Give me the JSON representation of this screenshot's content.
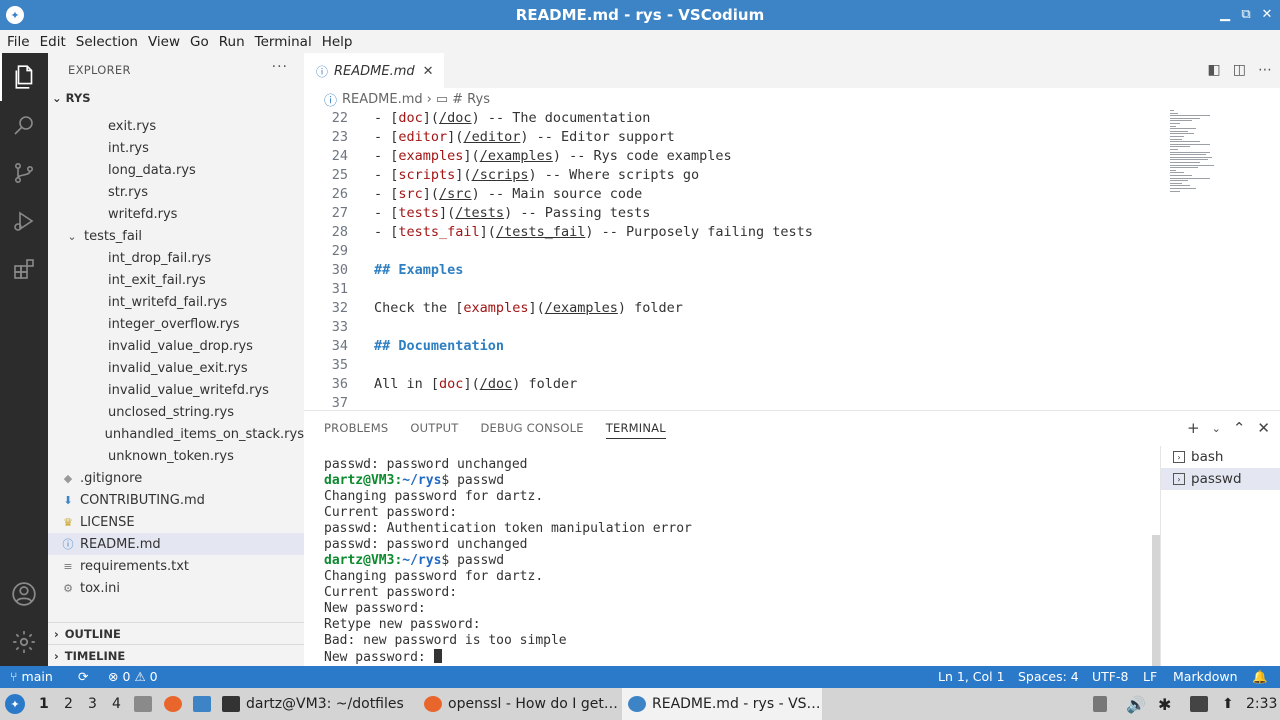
{
  "window": {
    "title": "README.md - rys - VSCodium",
    "controls": [
      "minimize-icon",
      "restore-icon",
      "close-icon"
    ]
  },
  "menu": [
    "File",
    "Edit",
    "Selection",
    "View",
    "Go",
    "Run",
    "Terminal",
    "Help"
  ],
  "activity_bar": [
    "explorer-icon",
    "search-icon",
    "source-control-icon",
    "run-debug-icon",
    "extensions-icon",
    "account-icon",
    "settings-gear-icon"
  ],
  "explorer": {
    "header": "EXPLORER",
    "more": "···",
    "root": "RYS",
    "items": [
      {
        "label": "exit.rys",
        "type": "rys"
      },
      {
        "label": "int.rys",
        "type": "rys"
      },
      {
        "label": "long_data.rys",
        "type": "rys"
      },
      {
        "label": "str.rys",
        "type": "rys"
      },
      {
        "label": "writefd.rys",
        "type": "rys"
      },
      {
        "label": "tests_fail",
        "type": "folder"
      },
      {
        "label": "int_drop_fail.rys",
        "type": "rys"
      },
      {
        "label": "int_exit_fail.rys",
        "type": "rys"
      },
      {
        "label": "int_writefd_fail.rys",
        "type": "rys"
      },
      {
        "label": "integer_overflow.rys",
        "type": "rys"
      },
      {
        "label": "invalid_value_drop.rys",
        "type": "rys"
      },
      {
        "label": "invalid_value_exit.rys",
        "type": "rys"
      },
      {
        "label": "invalid_value_writefd.rys",
        "type": "rys"
      },
      {
        "label": "unclosed_string.rys",
        "type": "rys"
      },
      {
        "label": "unhandled_items_on_stack.rys",
        "type": "rys"
      },
      {
        "label": "unknown_token.rys",
        "type": "rys"
      },
      {
        "label": ".gitignore",
        "type": "gitignore"
      },
      {
        "label": "CONTRIBUTING.md",
        "type": "md"
      },
      {
        "label": "LICENSE",
        "type": "license"
      },
      {
        "label": "README.md",
        "type": "info"
      },
      {
        "label": "requirements.txt",
        "type": "txt"
      },
      {
        "label": "tox.ini",
        "type": "ini"
      }
    ],
    "outline": "OUTLINE",
    "timeline": "TIMELINE"
  },
  "editor": {
    "tab_label": "README.md",
    "breadcrumb": {
      "file": "README.md",
      "symbol": "# Rys"
    },
    "lines": [
      {
        "n": "22",
        "label": "doc",
        "url": "/doc",
        "rest": " -- The documentation"
      },
      {
        "n": "23",
        "label": "editor",
        "url": "/editor",
        "rest": " -- Editor support"
      },
      {
        "n": "24",
        "label": "examples",
        "url": "/examples",
        "rest": " -- Rys code examples"
      },
      {
        "n": "25",
        "label": "scripts",
        "url": "/scrips",
        "rest": " -- Where scripts go"
      },
      {
        "n": "26",
        "label": "src",
        "url": "/src",
        "rest": " -- Main source code"
      },
      {
        "n": "27",
        "label": "tests",
        "url": "/tests",
        "rest": " -- Passing tests"
      },
      {
        "n": "28",
        "label": "tests_fail",
        "url": "/tests_fail",
        "rest": " -- Purposely failing tests"
      }
    ],
    "line29": "29",
    "line30": {
      "n": "30",
      "text": "## Examples"
    },
    "line31": "31",
    "line32": {
      "n": "32",
      "pre": "Check the ",
      "label": "examples",
      "url": "/examples",
      "post": " folder"
    },
    "line33": "33",
    "line34": {
      "n": "34",
      "text": "## Documentation"
    },
    "line35": "35",
    "line36": {
      "n": "36",
      "pre": "All in ",
      "label": "doc",
      "url": "/doc",
      "post": " folder"
    },
    "line37": "37"
  },
  "panel": {
    "tabs": [
      "PROBLEMS",
      "OUTPUT",
      "DEBUG CONSOLE",
      "TERMINAL"
    ],
    "active_tab": "TERMINAL",
    "terminal_lines": [
      {
        "kind": "text",
        "text": "passwd: password unchanged"
      },
      {
        "kind": "prompt",
        "user": "dartz@VM3",
        "path": "~/rys",
        "cmd": "$ passwd"
      },
      {
        "kind": "text",
        "text": "Changing password for dartz."
      },
      {
        "kind": "text",
        "text": "Current password:"
      },
      {
        "kind": "text",
        "text": "passwd: Authentication token manipulation error"
      },
      {
        "kind": "text",
        "text": "passwd: password unchanged"
      },
      {
        "kind": "prompt",
        "user": "dartz@VM3",
        "path": "~/rys",
        "cmd": "$ passwd"
      },
      {
        "kind": "text",
        "text": "Changing password for dartz."
      },
      {
        "kind": "text",
        "text": "Current password:"
      },
      {
        "kind": "text",
        "text": "New password:"
      },
      {
        "kind": "text",
        "text": "Retype new password:"
      },
      {
        "kind": "text",
        "text": "Bad: new password is too simple"
      },
      {
        "kind": "text",
        "text": "New password: "
      }
    ],
    "terminals": [
      "bash",
      "passwd"
    ]
  },
  "status": {
    "branch": "main",
    "errors": "0",
    "warnings": "0",
    "position": "Ln 1, Col 1",
    "spaces": "Spaces: 4",
    "encoding": "UTF-8",
    "eol": "LF",
    "language": "Markdown"
  },
  "taskbar": {
    "workspaces": [
      "1",
      "2",
      "3",
      "4"
    ],
    "windows": [
      {
        "label": "dartz@VM3: ~/dotfiles",
        "icon": "terminal-icon"
      },
      {
        "label": "openssl - How do I get…",
        "icon": "firefox-icon"
      },
      {
        "label": "README.md - rys - VS…",
        "icon": "vscodium-icon"
      }
    ],
    "clock": "2:33"
  }
}
